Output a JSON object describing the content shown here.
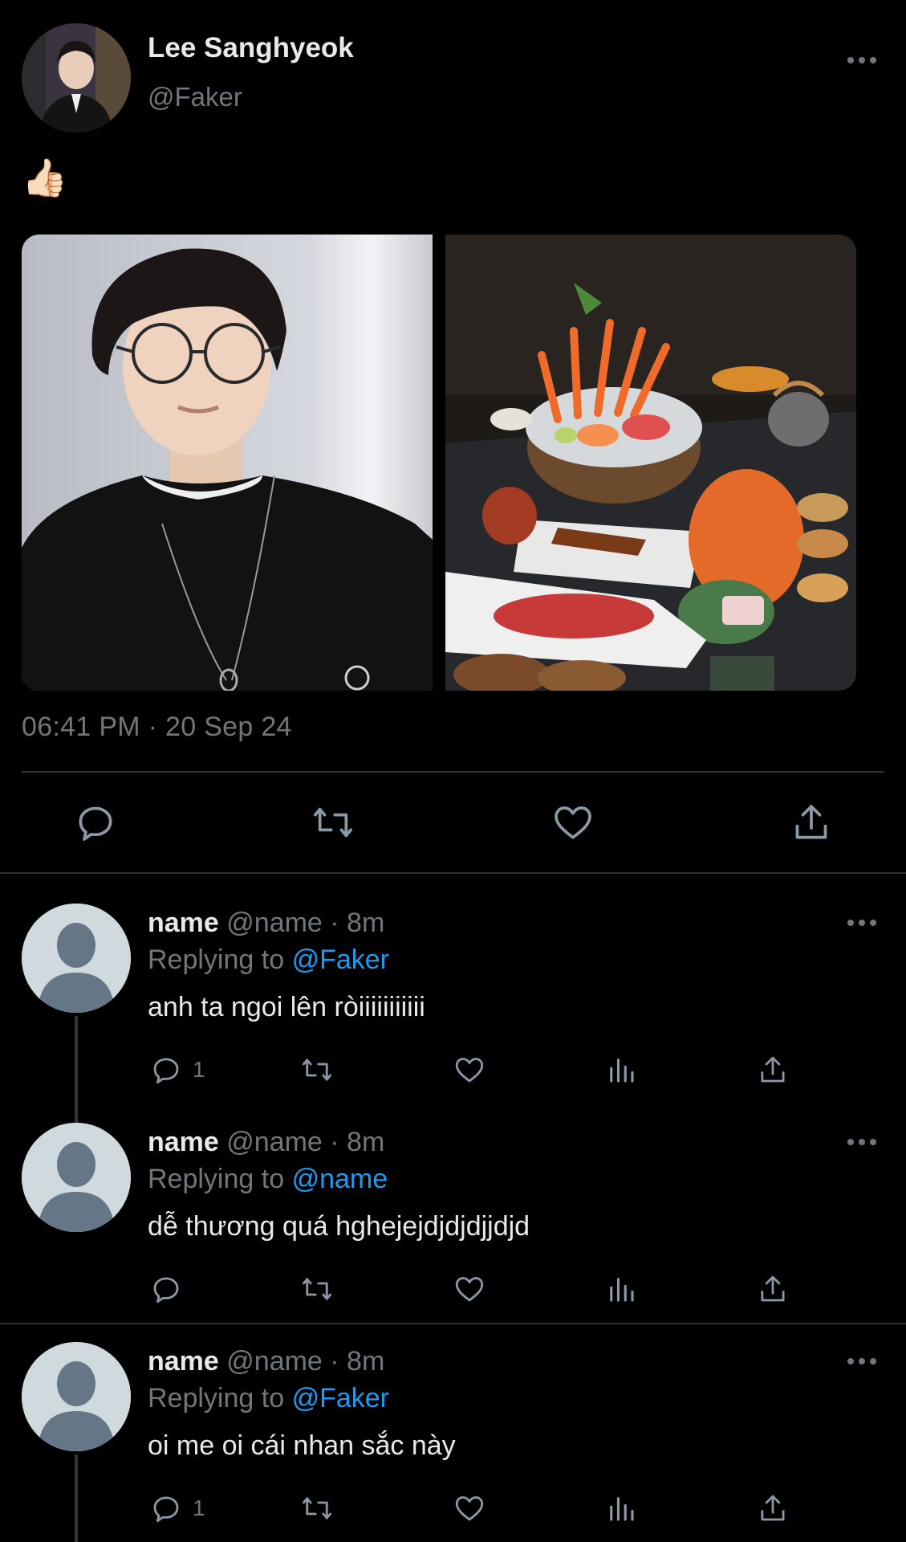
{
  "tweet": {
    "author_name": "Lee Sanghyeok",
    "author_handle": "@Faker",
    "text": "👍🏻",
    "timestamp": "06:41 PM · 20 Sep 24",
    "media": [
      {
        "alt": "portrait photo"
      },
      {
        "alt": "food photo"
      }
    ]
  },
  "replies": [
    {
      "name": "name",
      "meta": "@name · 8m",
      "replying_prefix": "Replying to",
      "replying_to": "@Faker",
      "text": "anh ta ngoi lên ròiiiiiiiiiii",
      "reply_count": "1"
    },
    {
      "name": "name",
      "meta": "@name · 8m",
      "replying_prefix": "Replying to",
      "replying_to": "@name",
      "text": "dễ thương quá hghejejdjdjdjjdjd",
      "reply_count": ""
    },
    {
      "name": "name",
      "meta": "@name · 8m",
      "replying_prefix": "Replying to",
      "replying_to": "@Faker",
      "text": "oi me oi cái nhan sắc này",
      "reply_count": "1"
    }
  ],
  "icons": {
    "reply": "speech-bubble-icon",
    "retweet": "retweet-icon",
    "like": "heart-icon",
    "views": "bar-chart-icon",
    "share": "share-icon",
    "more": "more-dots-icon"
  },
  "colors": {
    "background": "#000000",
    "text": "#e7e9ea",
    "muted": "#71767b",
    "accent": "#1d9bf0",
    "divider": "#2f3336"
  }
}
